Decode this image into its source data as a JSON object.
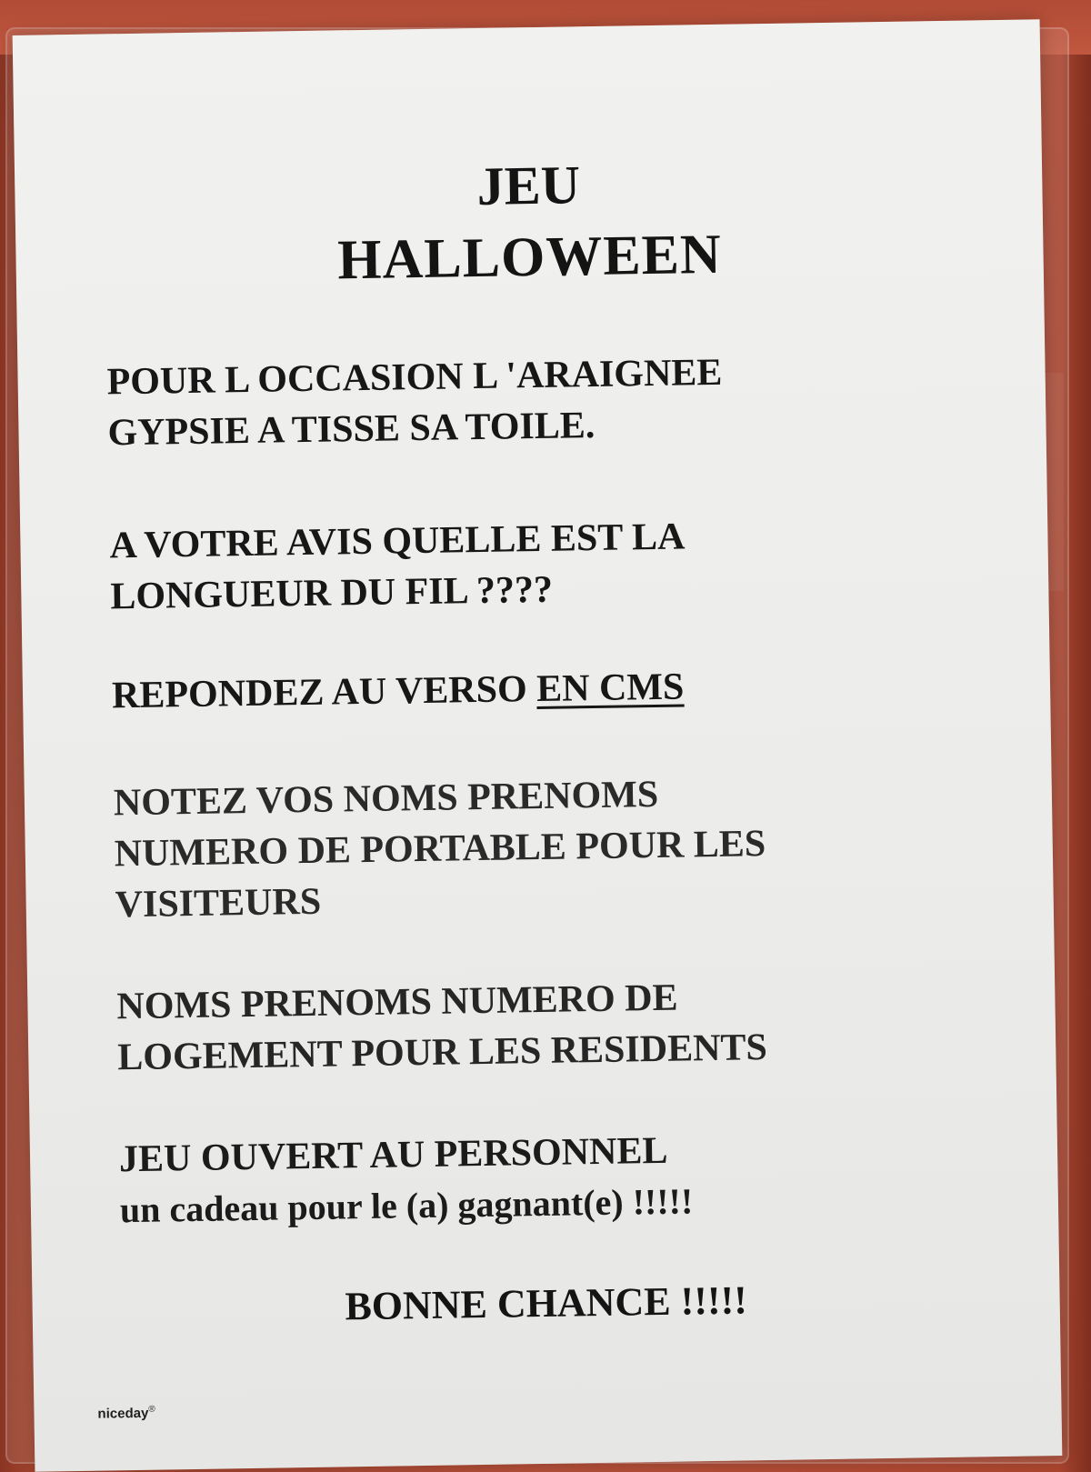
{
  "flyer": {
    "title_line1": "JEU",
    "title_line2": "HALLOWEEN",
    "intro": [
      "POUR L OCCASION L 'ARAIGNEE",
      "GYPSIE A TISSE SA TOILE."
    ],
    "question": [
      "A VOTRE AVIS QUELLE EST LA",
      "LONGUEUR DU FIL ????"
    ],
    "repondez_text": "REPONDEZ AU VERSO",
    "repondez_unit": "EN CMS",
    "visiteurs": [
      "NOTEZ VOS NOMS PRENOMS",
      "NUMERO DE PORTABLE POUR LES",
      "VISITEURS"
    ],
    "residents": [
      "NOMS PRENOMS NUMERO DE",
      "LOGEMENT POUR LES RESIDENTS"
    ],
    "personnel": "JEU OUVERT AU PERSONNEL",
    "cadeau": "un cadeau pour le (a) gagnant(e) !!!!!",
    "bonne_chance": "BONNE CHANCE !!!!!",
    "brand": "niceday",
    "brand_mark": "®"
  },
  "colors": {
    "background": "#b5503a",
    "paper": "#eeeeec",
    "ink": "#151515"
  }
}
